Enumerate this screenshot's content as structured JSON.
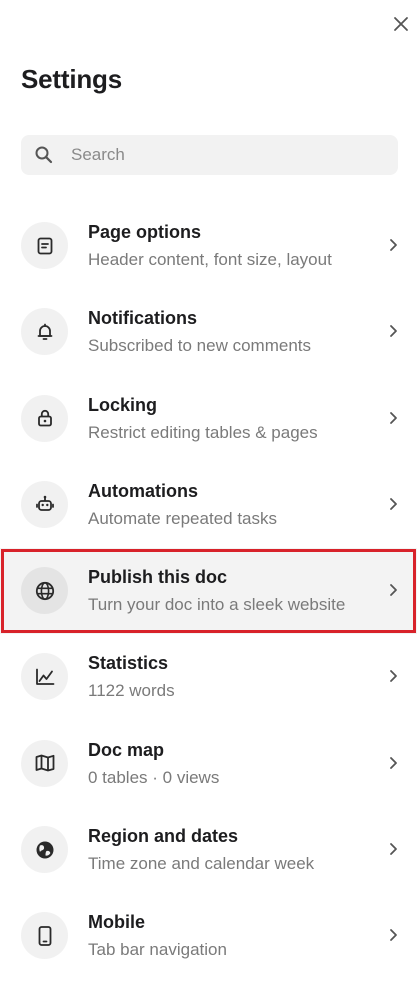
{
  "header": {
    "title": "Settings",
    "close_icon": "close-icon"
  },
  "search": {
    "placeholder": "Search",
    "value": "",
    "icon": "search-icon"
  },
  "items": [
    {
      "label": "Page options",
      "description": "Header content, font size, layout",
      "icon": "page-icon"
    },
    {
      "label": "Notifications",
      "description": "Subscribed to new comments",
      "icon": "bell-icon"
    },
    {
      "label": "Locking",
      "description": "Restrict editing tables & pages",
      "icon": "lock-icon"
    },
    {
      "label": "Automations",
      "description": "Automate repeated tasks",
      "icon": "robot-icon"
    },
    {
      "label": "Publish this doc",
      "description": "Turn your doc into a sleek website",
      "icon": "globe-icon",
      "highlighted": true
    },
    {
      "label": "Statistics",
      "description": "1122 words",
      "icon": "chart-icon"
    },
    {
      "label": "Doc map",
      "description": "0 tables · 0 views",
      "icon": "map-icon"
    },
    {
      "label": "Region and dates",
      "description": "Time zone and calendar week",
      "icon": "region-icon"
    },
    {
      "label": "Mobile",
      "description": "Tab bar navigation",
      "icon": "mobile-icon"
    }
  ],
  "colors": {
    "highlight_border": "#d8222a",
    "text_primary": "#1d1d1f",
    "text_secondary": "#7a7a7a",
    "icon_bg": "#f1f1f1"
  }
}
